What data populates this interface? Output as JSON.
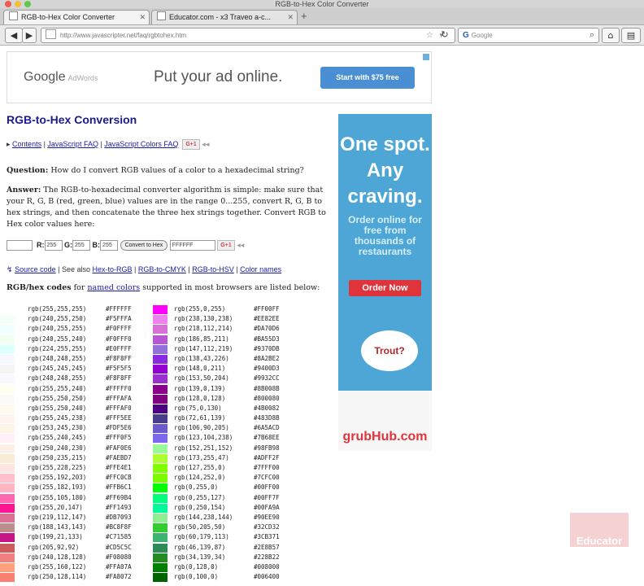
{
  "window": {
    "title": "RGB-to-Hex Color Converter"
  },
  "tabs": [
    {
      "label": "RGB-to-Hex Color Converter",
      "active": true
    },
    {
      "label": "Educator.com - x3 Traveo a-c...",
      "active": false
    }
  ],
  "nav": {
    "back": "◀",
    "forward": "▶",
    "url": "http://www.javascripter.net/faq/rgbtohex.htm",
    "search_placeholder": "Google",
    "search_engine": "G",
    "home": "⌂"
  },
  "ad_top": {
    "logo": "Google",
    "logo_suffix": "AdWords",
    "slogan": "Put your ad online.",
    "cta": "Start with $75 free"
  },
  "page": {
    "title": "RGB-to-Hex Conversion",
    "links1": [
      "Contents",
      "JavaScript FAQ",
      "JavaScript Colors FAQ"
    ],
    "question_label": "Question:",
    "question_text": "How do I convert RGB values of a color to a hexadecimal string?",
    "answer_label": "Answer:",
    "answer_text": "The RGB-to-hexadecimal converter algorithm is simple: make sure that your R, G, B (red, green, blue) values are in the range 0...255, convert R, G, B to hex strings, and then concatenate the three hex strings together. Convert RGB to Hex color values here:",
    "converter": {
      "r_label": "R:",
      "r_value": "255",
      "g_label": "G:",
      "g_value": "255",
      "b_label": "B:",
      "b_value": "255",
      "button": "Convert to Hex",
      "result": "FFFFFF"
    },
    "see_also_prefix": "See also",
    "links2": [
      "Source code",
      "Hex-to-RGB",
      "RGB-to-CMYK",
      "RGB-to-HSV",
      "Color names"
    ],
    "list_intro_bold": "RGB/hex codes",
    "list_intro_pre": "for",
    "list_intro_link": "named colors",
    "list_intro_post": "supported in most browsers are listed below:"
  },
  "codes_left": [
    {
      "rgb": "rgb(255,255,255)",
      "hex": "#FFFFFF",
      "color": "#FFFFFF"
    },
    {
      "rgb": "rgb(240,255,250)",
      "hex": "#F5FFFA",
      "color": "#F5FFFA"
    },
    {
      "rgb": "rgb(240,255,255)",
      "hex": "#F0FFFF",
      "color": "#F0FFFF"
    },
    {
      "rgb": "rgb(240,255,240)",
      "hex": "#F0FFF0",
      "color": "#F0FFF0"
    },
    {
      "rgb": "rgb(224,255,255)",
      "hex": "#E0FFFF",
      "color": "#E0FFFF"
    },
    {
      "rgb": "rgb(248,248,255)",
      "hex": "#F8F8FF",
      "color": "#F8F8FF"
    },
    {
      "rgb": "rgb(245,245,245)",
      "hex": "#F5F5F5",
      "color": "#F5F5F5"
    },
    {
      "rgb": "rgb(248,248,255)",
      "hex": "#F8F8FF",
      "color": "#F8F8FF"
    },
    {
      "rgb": "rgb(255,255,240)",
      "hex": "#FFFFF0",
      "color": "#FFFFF0"
    },
    {
      "rgb": "rgb(255,250,250)",
      "hex": "#FFFAFA",
      "color": "#FFFAFA"
    },
    {
      "rgb": "rgb(255,250,240)",
      "hex": "#FFFAF0",
      "color": "#FFFAF0"
    },
    {
      "rgb": "rgb(255,245,238)",
      "hex": "#FFF5EE",
      "color": "#FFF5EE"
    },
    {
      "rgb": "rgb(253,245,230)",
      "hex": "#FDF5E6",
      "color": "#FDF5E6"
    },
    {
      "rgb": "rgb(255,240,245)",
      "hex": "#FFF0F5",
      "color": "#FFF0F5"
    },
    {
      "rgb": "rgb(250,240,230)",
      "hex": "#FAF0E6",
      "color": "#FAF0E6"
    },
    {
      "rgb": "rgb(250,235,215)",
      "hex": "#FAEBD7",
      "color": "#FAEBD7"
    },
    {
      "rgb": "rgb(255,228,225)",
      "hex": "#FFE4E1",
      "color": "#FFE4E1"
    },
    {
      "rgb": "rgb(255,192,203)",
      "hex": "#FFC0CB",
      "color": "#FFC0CB"
    },
    {
      "rgb": "rgb(255,182,193)",
      "hex": "#FFB6C1",
      "color": "#FFB6C1"
    },
    {
      "rgb": "rgb(255,105,180)",
      "hex": "#FF69B4",
      "color": "#FF69B4"
    },
    {
      "rgb": "rgb(255,20,147)",
      "hex": "#FF1493",
      "color": "#FF1493"
    },
    {
      "rgb": "rgb(219,112,147)",
      "hex": "#DB7093",
      "color": "#DB7093"
    },
    {
      "rgb": "rgb(188,143,143)",
      "hex": "#BC8F8F",
      "color": "#BC8F8F"
    },
    {
      "rgb": "rgb(199,21,133)",
      "hex": "#C71585",
      "color": "#C71585"
    },
    {
      "rgb": "rgb(205,92,92)",
      "hex": "#CD5C5C",
      "color": "#CD5C5C"
    },
    {
      "rgb": "rgb(240,128,128)",
      "hex": "#F08080",
      "color": "#F08080"
    },
    {
      "rgb": "rgb(255,160,122)",
      "hex": "#FFA07A",
      "color": "#FFA07A"
    },
    {
      "rgb": "rgb(250,128,114)",
      "hex": "#FA8072",
      "color": "#FA8072"
    }
  ],
  "codes_right": [
    {
      "rgb": "rgb(255,0,255)",
      "hex": "#FF00FF",
      "color": "#FF00FF"
    },
    {
      "rgb": "rgb(238,130,238)",
      "hex": "#EE82EE",
      "color": "#EE82EE"
    },
    {
      "rgb": "rgb(218,112,214)",
      "hex": "#DA70D6",
      "color": "#DA70D6"
    },
    {
      "rgb": "rgb(186,85,211)",
      "hex": "#BA55D3",
      "color": "#BA55D3"
    },
    {
      "rgb": "rgb(147,112,219)",
      "hex": "#9370DB",
      "color": "#9370DB"
    },
    {
      "rgb": "rgb(138,43,226)",
      "hex": "#8A2BE2",
      "color": "#8A2BE2"
    },
    {
      "rgb": "rgb(148,0,211)",
      "hex": "#9400D3",
      "color": "#9400D3"
    },
    {
      "rgb": "rgb(153,50,204)",
      "hex": "#9932CC",
      "color": "#9932CC"
    },
    {
      "rgb": "rgb(139,0,139)",
      "hex": "#8B008B",
      "color": "#8B008B"
    },
    {
      "rgb": "rgb(128,0,128)",
      "hex": "#800080",
      "color": "#800080"
    },
    {
      "rgb": "rgb(75,0,130)",
      "hex": "#4B0082",
      "color": "#4B0082"
    },
    {
      "rgb": "rgb(72,61,139)",
      "hex": "#483D8B",
      "color": "#483D8B"
    },
    {
      "rgb": "rgb(106,90,205)",
      "hex": "#6A5ACD",
      "color": "#6A5ACD"
    },
    {
      "rgb": "rgb(123,104,238)",
      "hex": "#7B68EE",
      "color": "#7B68EE"
    },
    {
      "rgb": "rgb(152,251,152)",
      "hex": "#98FB98",
      "color": "#98FB98"
    },
    {
      "rgb": "rgb(173,255,47)",
      "hex": "#ADFF2F",
      "color": "#ADFF2F"
    },
    {
      "rgb": "rgb(127,255,0)",
      "hex": "#7FFF00",
      "color": "#7FFF00"
    },
    {
      "rgb": "rgb(124,252,0)",
      "hex": "#7CFC00",
      "color": "#7CFC00"
    },
    {
      "rgb": "rgb(0,255,0)",
      "hex": "#00FF00",
      "color": "#00FF00"
    },
    {
      "rgb": "rgb(0,255,127)",
      "hex": "#00FF7F",
      "color": "#00FF7F"
    },
    {
      "rgb": "rgb(0,250,154)",
      "hex": "#00FA9A",
      "color": "#00FA9A"
    },
    {
      "rgb": "rgb(144,238,144)",
      "hex": "#90EE90",
      "color": "#90EE90"
    },
    {
      "rgb": "rgb(50,205,50)",
      "hex": "#32CD32",
      "color": "#32CD32"
    },
    {
      "rgb": "rgb(60,179,113)",
      "hex": "#3CB371",
      "color": "#3CB371"
    },
    {
      "rgb": "rgb(46,139,87)",
      "hex": "#2E8B57",
      "color": "#2E8B57"
    },
    {
      "rgb": "rgb(34,139,34)",
      "hex": "#228B22",
      "color": "#228B22"
    },
    {
      "rgb": "rgb(0,128,0)",
      "hex": "#008000",
      "color": "#008000"
    },
    {
      "rgb": "rgb(0,100,0)",
      "hex": "#006400",
      "color": "#006400"
    }
  ],
  "ad_right": {
    "headline": "One spot. Any craving.",
    "sub": "Order online for free from thousands of restaurants",
    "cta": "Order Now",
    "bubble": "Trout?",
    "brand": "grubHub.com"
  },
  "watermark": "Educator",
  "colors": {
    "link": "#1a1aa6",
    "title": "#1b1b8f",
    "ad_blue": "#4da6d6",
    "ad_red": "#e0343c"
  }
}
